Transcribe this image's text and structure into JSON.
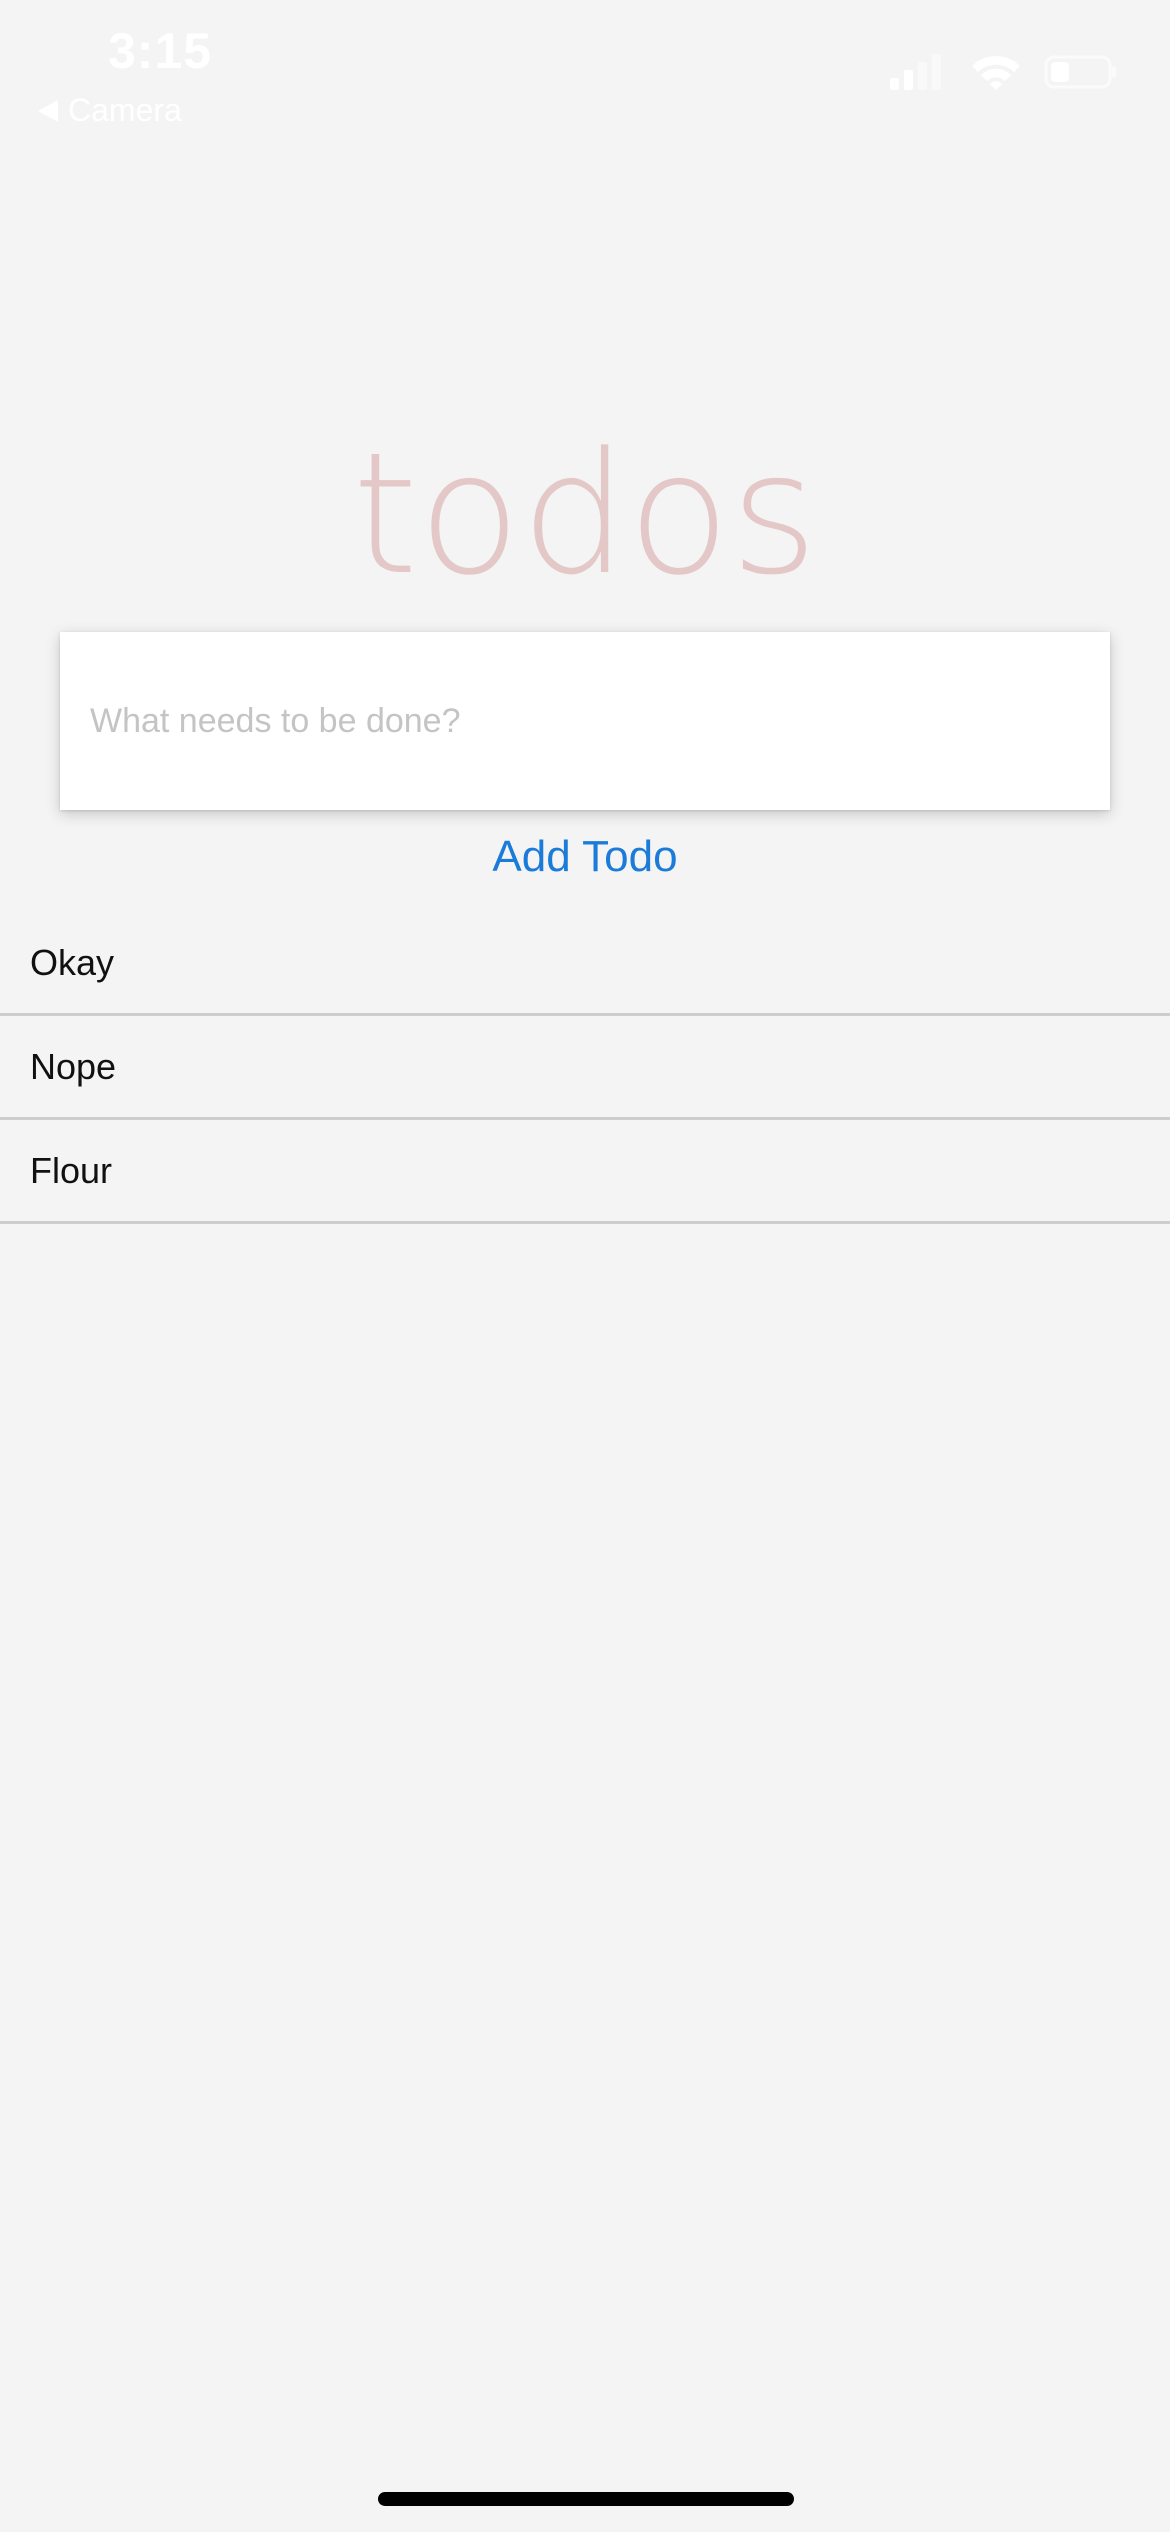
{
  "status_bar": {
    "time": "3:15",
    "back_label": "Camera",
    "icons": [
      "back-arrow-icon",
      "cellular-signal-icon",
      "wifi-icon",
      "battery-icon"
    ]
  },
  "app": {
    "title": "todos",
    "input_placeholder": "What needs to be done?",
    "input_value": "",
    "add_button_label": "Add Todo",
    "todos": [
      {
        "text": "Okay"
      },
      {
        "text": "Nope"
      },
      {
        "text": "Flour"
      }
    ]
  },
  "colors": {
    "background": "#f4f4f4",
    "title": "#e8c6c6",
    "accent": "#1a7bd8",
    "divider": "#cdcdcd",
    "status_text": "#ffffff"
  }
}
